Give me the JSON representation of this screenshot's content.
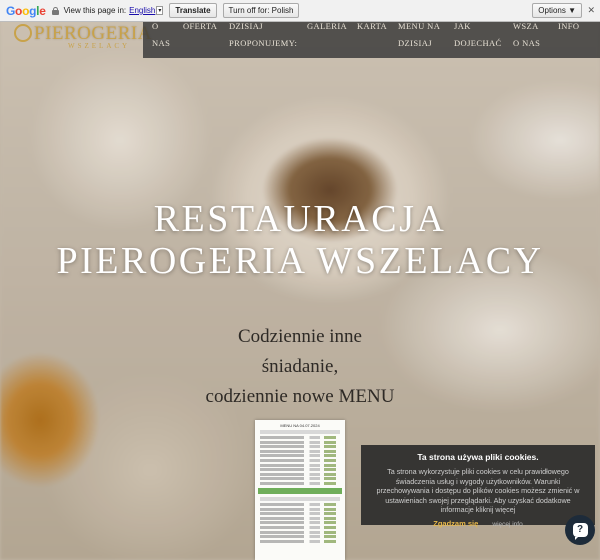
{
  "translate_bar": {
    "logo": "Google",
    "view_text": "View this page in:",
    "language": "English",
    "translate_button": "Translate",
    "turn_off_button": "Turn off for: Polish",
    "options_button": "Options ▼",
    "close": "✕"
  },
  "logo": {
    "title": "PIEROGERIA",
    "subtitle": "WSZELACY"
  },
  "nav": {
    "items": [
      {
        "line1": "O",
        "line2": "NAS"
      },
      {
        "line1": "OFERTA",
        "line2": ""
      },
      {
        "line1": "DZISIAJ",
        "line2": "PROPONUJEMY:"
      },
      {
        "line1": "GALERIA",
        "line2": ""
      },
      {
        "line1": "KARTA",
        "line2": ""
      },
      {
        "line1": "MENU NA",
        "line2": "DZISIAJ"
      },
      {
        "line1": "JAK",
        "line2": "DOJECHAĆ"
      },
      {
        "line1": "WSZA",
        "line2": "O NAS"
      },
      {
        "line1": "INFO",
        "line2": ""
      }
    ]
  },
  "hero": {
    "headline_line1": "RESTAURACJA",
    "headline_line2": "PIEROGERIA WSZELACY",
    "sub_line1": "Codziennie inne",
    "sub_line2": "śniadanie,",
    "sub_line3": "codziennie nowe MENU"
  },
  "menu_image": {
    "title": "MENU NA 04.07.2024"
  },
  "cookie": {
    "title": "Ta strona używa pliki cookies.",
    "body": "Ta strona wykorzystuje pliki cookies w celu prawidłowego świadczenia usług i wygody użytkowników. Warunki przechowywania i dostępu do plików cookies możesz zmienić w ustawieniach swojej przeglądarki. Aby uzyskać dodatkowe informacje kliknij więcej",
    "accept": "Zgadzam się",
    "more": "więcej info"
  },
  "chat": {
    "icon": "chat-bubble-icon",
    "glyph": "?"
  }
}
